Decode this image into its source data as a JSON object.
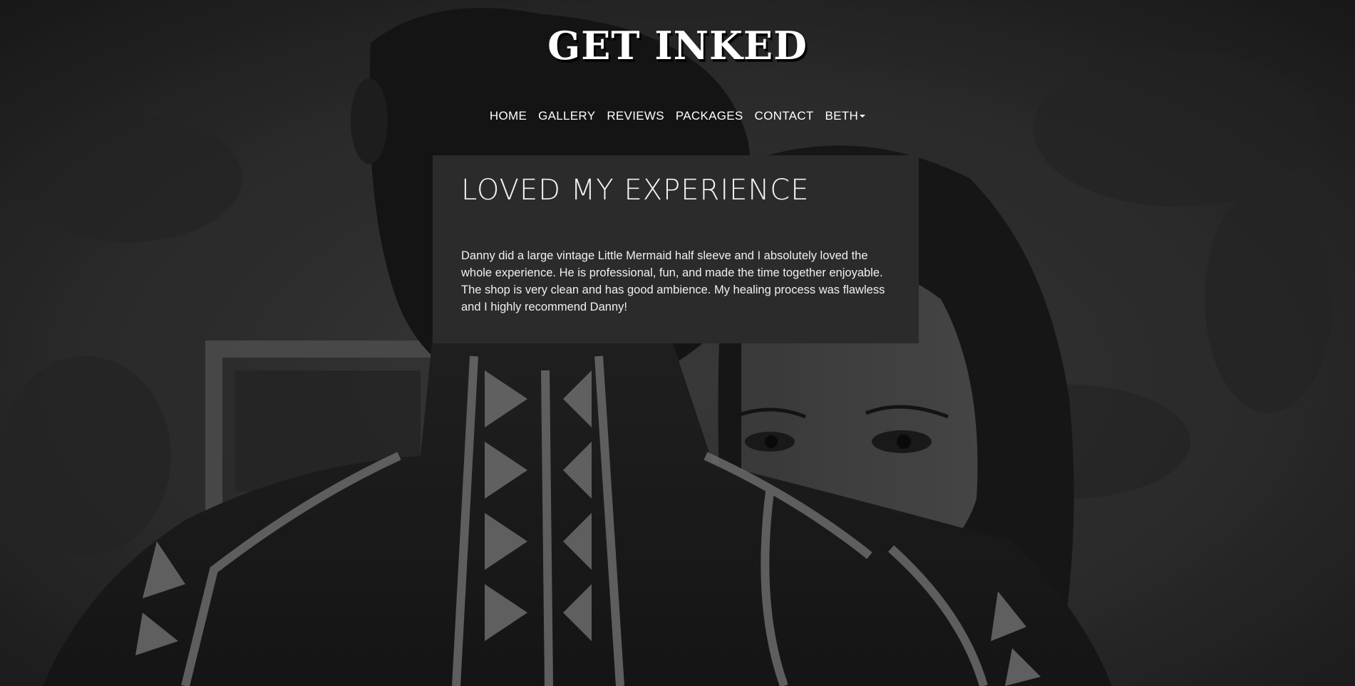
{
  "brand": {
    "logo_text": "GET INKED"
  },
  "nav": {
    "items": [
      {
        "label": "HOME"
      },
      {
        "label": "GALLERY"
      },
      {
        "label": "REVIEWS"
      },
      {
        "label": "PACKAGES"
      },
      {
        "label": "CONTACT"
      },
      {
        "label": "BETH",
        "dropdown": true
      }
    ]
  },
  "review": {
    "title": "LOVED MY EXPERIENCE",
    "body": "Danny did a large vintage Little Mermaid half sleeve and I absolutely loved the whole experience. He is professional, fun, and made the time together enjoyable. The shop is very clean and has good ambience. My healing process was flawless and I highly recommend Danny!"
  },
  "colors": {
    "card_background": "#2b2b2b",
    "text": "#ffffff"
  }
}
